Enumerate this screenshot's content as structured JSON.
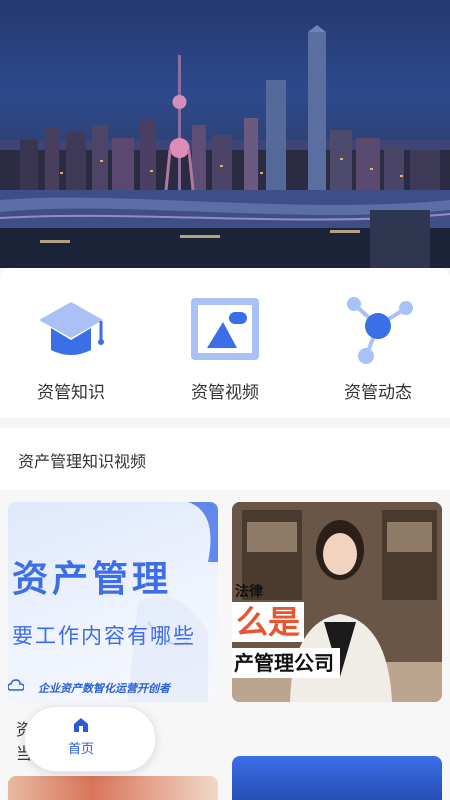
{
  "quick_menu": {
    "items": [
      {
        "label": "资管知识",
        "icon": "graduation-cap-icon"
      },
      {
        "label": "资管视频",
        "icon": "image-frame-icon"
      },
      {
        "label": "资管动态",
        "icon": "network-nodes-icon"
      }
    ]
  },
  "section": {
    "title": "资产管理知识视频"
  },
  "cards": [
    {
      "title": "资产管理",
      "subtitle": "要工作内容有哪些",
      "footer": "企业资产数智化运营开创者"
    },
    {
      "caption_1": "法律",
      "caption_2": "么是",
      "caption_3": "产管理公司"
    }
  ],
  "row2": {
    "clip_text": "资\n当"
  },
  "tabbar": {
    "home_label": "首页"
  },
  "colors": {
    "accent": "#2b5bd7",
    "icon_blue": "#4a7cf0",
    "icon_light": "#a9c1f7"
  }
}
